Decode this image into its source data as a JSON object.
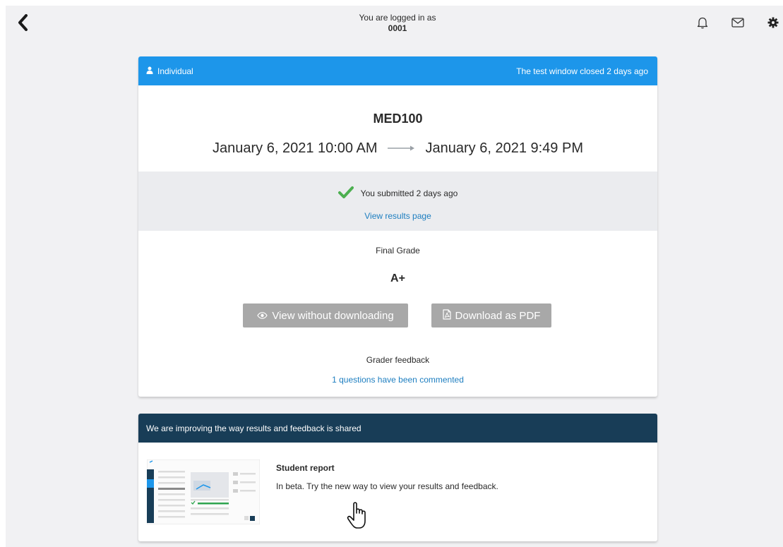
{
  "topbar": {
    "login_line1": "You are logged in as",
    "login_user": "0001",
    "icons": [
      "back-chevron-icon",
      "bell-icon",
      "mail-icon",
      "gear-icon"
    ]
  },
  "exam_card": {
    "type_label": "Individual",
    "window_status": "The test window closed 2 days ago",
    "course_code": "MED100",
    "start": "January 6, 2021 10:00 AM",
    "end": "January 6, 2021 9:49 PM",
    "submitted_text": "You submitted 2 days ago",
    "results_link": "View results page",
    "final_grade_label": "Final Grade",
    "final_grade": "A+",
    "view_button": "View without downloading",
    "pdf_button": "Download as PDF",
    "feedback_label": "Grader feedback",
    "feedback_link": "1 questions have been commented"
  },
  "report_card": {
    "header": "We are improving the way results and feedback is shared",
    "title": "Student report",
    "description": "In beta. Try the new way to view your results and feedback."
  },
  "colors": {
    "header_blue": "#1d96ea",
    "header_navy": "#183d57",
    "link_blue": "#1d7ec0",
    "check_green": "#4caf50",
    "button_gray": "#a8a8a8"
  }
}
